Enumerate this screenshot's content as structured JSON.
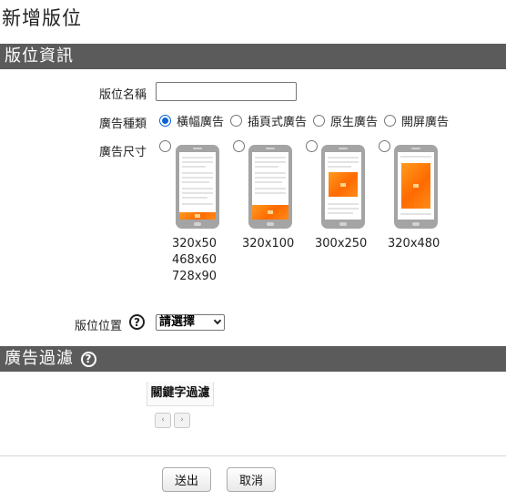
{
  "page": {
    "title": "新增版位"
  },
  "sections": {
    "info": {
      "title": "版位資訊"
    },
    "filter": {
      "title": "廣告過濾",
      "help_icon": "?"
    }
  },
  "form": {
    "name_label": "版位名稱",
    "name_value": "",
    "type_label": "廣告種類",
    "types": [
      {
        "label": "橫幅廣告",
        "checked": true
      },
      {
        "label": "插頁式廣告",
        "checked": false
      },
      {
        "label": "原生廣告",
        "checked": false
      },
      {
        "label": "開屏廣告",
        "checked": false
      }
    ],
    "size_label": "廣告尺寸",
    "sizes": [
      {
        "lines": [
          "320x50",
          "468x60",
          "728x90"
        ],
        "checked": false
      },
      {
        "lines": [
          "320x100"
        ],
        "checked": false
      },
      {
        "lines": [
          "300x250"
        ],
        "checked": false
      },
      {
        "lines": [
          "320x480"
        ],
        "checked": false
      }
    ],
    "position_label": "版位位置",
    "position_help_icon": "?",
    "position_select": "請選擇"
  },
  "filter": {
    "keyword_header": "關鍵字過濾",
    "prev_icon": "‹",
    "next_icon": "›"
  },
  "buttons": {
    "submit": "送出",
    "cancel": "取消"
  },
  "icons": {
    "help": "help-circle-icon",
    "prev": "chevron-left-icon",
    "next": "chevron-right-icon",
    "select": "chevron-down-icon"
  },
  "colors": {
    "section_bar": "#5b5b5b",
    "radio_checked": "#0b63d6",
    "ad_orange": "#ff6a00"
  }
}
